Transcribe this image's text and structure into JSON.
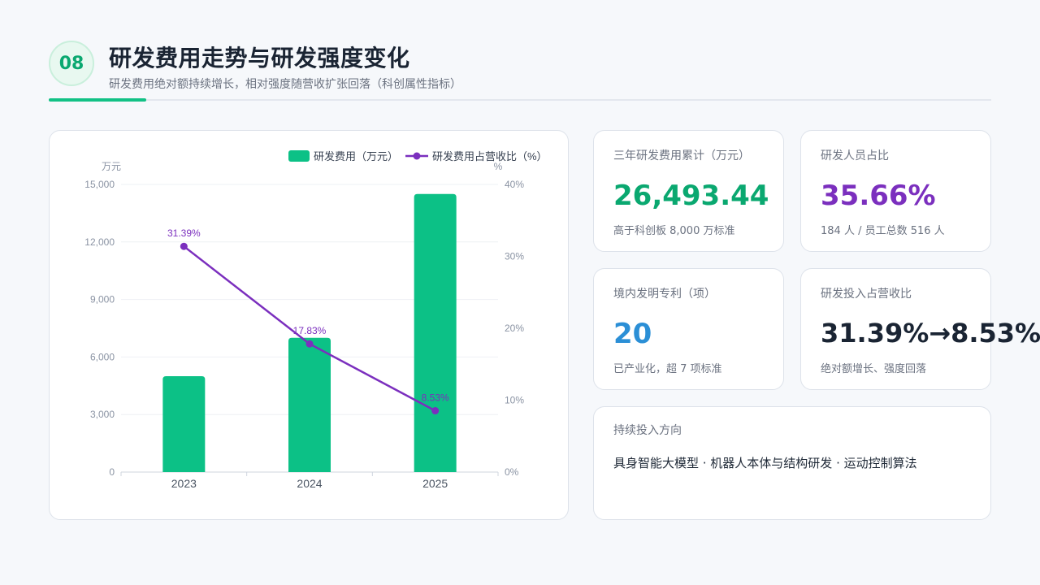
{
  "header": {
    "number": "08",
    "title": "研发费用走势与研发强度变化",
    "subtitle": "研发费用绝对额持续增长，相对强度随营收扩张回落（科创属性指标）"
  },
  "chart_data": {
    "type": "bar",
    "categories": [
      "2023",
      "2024",
      "2025"
    ],
    "series": [
      {
        "name": "研发费用（万元）",
        "type": "bar",
        "axis": "left",
        "values": [
          5000,
          7000,
          14500
        ]
      },
      {
        "name": "研发费用占营收比（%）",
        "type": "line",
        "axis": "right",
        "values": [
          31.39,
          17.83,
          8.53
        ],
        "data_labels": [
          "31.39%",
          "17.83%",
          "8.53%"
        ]
      }
    ],
    "ylabel": "万元",
    "y2label": "%",
    "ylim": [
      0,
      15000
    ],
    "y2lim": [
      0,
      40
    ],
    "yticks": [
      "0",
      "3,000",
      "6,000",
      "9,000",
      "12,000",
      "15,000"
    ],
    "y2ticks": [
      "0%",
      "10%",
      "20%",
      "30%",
      "40%"
    ],
    "legend": "top-right",
    "grid": true,
    "colors": {
      "bar": "#0cc186",
      "line": "#7b2fbe"
    }
  },
  "stats": {
    "total": {
      "label": "三年研发费用累计（万元）",
      "value": "26,493.44",
      "note": "高于科创板 8,000 万标准",
      "color": "#0aa870"
    },
    "staff": {
      "label": "研发人员占比",
      "value": "35.66%",
      "note": "184 人 / 员工总数 516 人",
      "color": "#7b2fbe"
    },
    "patents": {
      "label": "境内发明专利（项）",
      "value": "20",
      "note": "已产业化，超 7 项标准",
      "color": "#2b8fd6"
    },
    "ratio": {
      "label": "研发投入占营收比",
      "value": "31.39%→8.53%",
      "note": "绝对额增长、强度回落",
      "color": "#1a2433"
    }
  },
  "direction": {
    "label": "持续投入方向",
    "text": "具身智能大模型 · 机器人本体与结构研发 · 运动控制算法"
  }
}
